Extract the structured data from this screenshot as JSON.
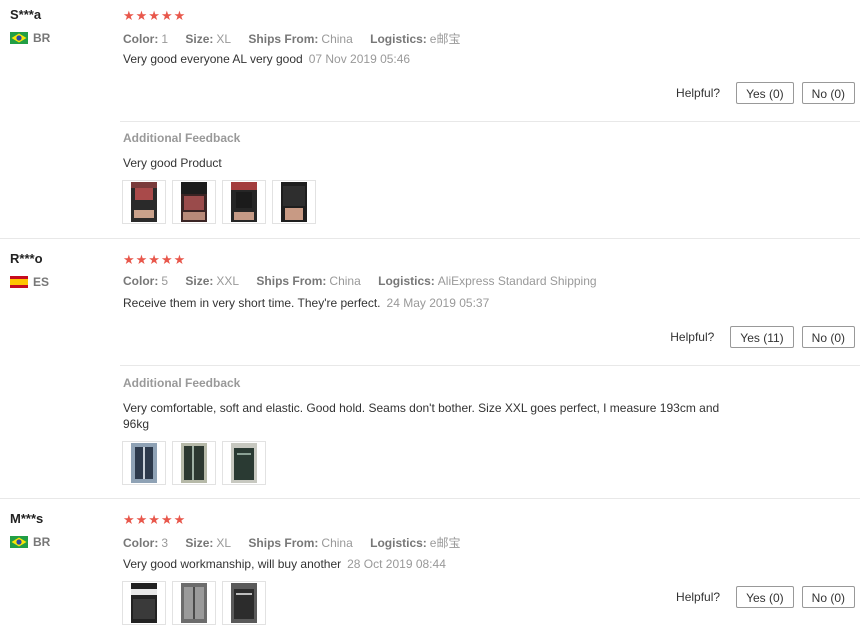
{
  "colors": {
    "star": "#e8574b",
    "meta": "#999999",
    "border": "#e8e8e8"
  },
  "reviews": [
    {
      "user": "S***a",
      "country": "BR",
      "flag_icon": "brazil-flag-icon",
      "stars": "★★★★★",
      "color_label": "Color:",
      "color_value": "1",
      "size_label": "Size:",
      "size_value": "XL",
      "ships_label": "Ships From:",
      "ships_value": "China",
      "logistics_label": "Logistics:",
      "logistics_value": "e邮宝",
      "text": "Very good everyone AL very good",
      "date": "07 Nov 2019 05:46",
      "helpful_label": "Helpful?",
      "yes_label": "Yes (0)",
      "no_label": "No (0)",
      "additional_title": "Additional Feedback",
      "additional_text": "Very good Product",
      "images": [
        "review-photo",
        "review-photo",
        "review-photo",
        "review-photo"
      ]
    },
    {
      "user": "R***o",
      "country": "ES",
      "flag_icon": "spain-flag-icon",
      "stars": "★★★★★",
      "color_label": "Color:",
      "color_value": "5",
      "size_label": "Size:",
      "size_value": "XXL",
      "ships_label": "Ships From:",
      "ships_value": "China",
      "logistics_label": "Logistics:",
      "logistics_value": "AliExpress Standard Shipping",
      "text": "Receive them in very short time. They're perfect.",
      "date": "24 May 2019 05:37",
      "helpful_label": "Helpful?",
      "yes_label": "Yes (11)",
      "no_label": "No (0)",
      "additional_title": "Additional Feedback",
      "additional_text": "Very comfortable, soft and elastic. Good hold. Seams don't bother. Size XXL goes perfect, I measure 193cm and 96kg",
      "images": [
        "review-photo",
        "review-photo",
        "review-photo"
      ]
    },
    {
      "user": "M***s",
      "country": "BR",
      "flag_icon": "brazil-flag-icon",
      "stars": "★★★★★",
      "color_label": "Color:",
      "color_value": "3",
      "size_label": "Size:",
      "size_value": "XL",
      "ships_label": "Ships From:",
      "ships_value": "China",
      "logistics_label": "Logistics:",
      "logistics_value": "e邮宝",
      "text": "Very good workmanship, will buy another",
      "date": "28 Oct 2019 08:44",
      "helpful_label": "Helpful?",
      "yes_label": "Yes (0)",
      "no_label": "No (0)",
      "images": [
        "review-photo",
        "review-photo",
        "review-photo"
      ]
    }
  ]
}
